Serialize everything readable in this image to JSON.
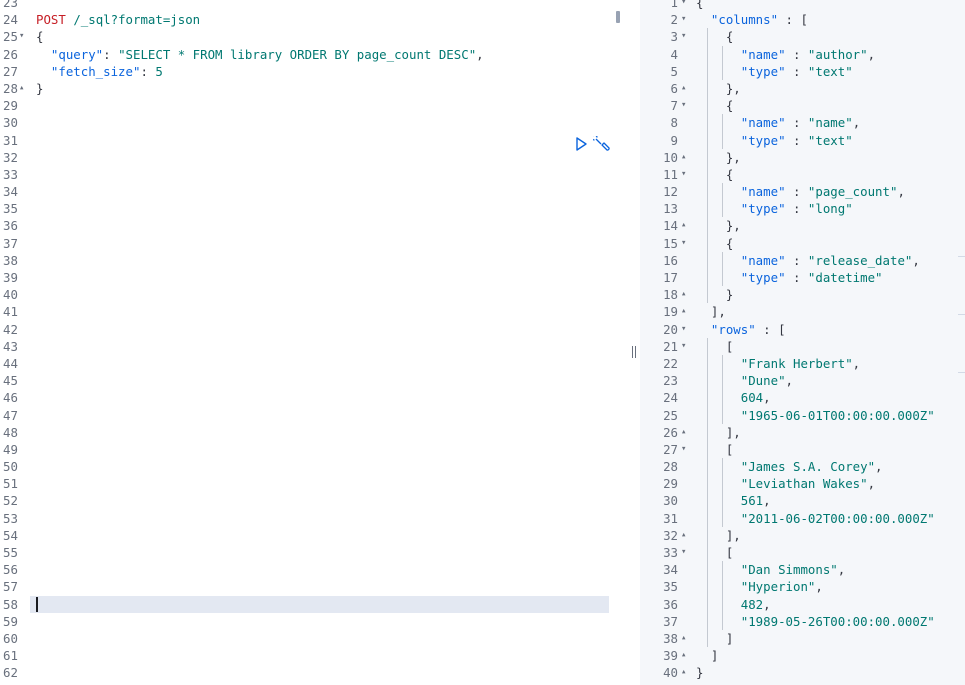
{
  "request": {
    "method": "POST",
    "path": "/_sql?format=json",
    "lines": [
      {
        "n": "23",
        "fold": "",
        "code": ""
      },
      {
        "n": "24",
        "fold": "",
        "code": "__REQ__"
      },
      {
        "n": "25",
        "fold": "▾",
        "code": "{"
      },
      {
        "n": "26",
        "fold": "",
        "code": "  \"query\": \"SELECT * FROM library ORDER BY page_count DESC\","
      },
      {
        "n": "27",
        "fold": "",
        "code": "  \"fetch_size\": 5"
      },
      {
        "n": "28",
        "fold": "▴",
        "code": "}"
      },
      {
        "n": "29",
        "fold": "",
        "code": ""
      },
      {
        "n": "30",
        "fold": "",
        "code": ""
      },
      {
        "n": "31",
        "fold": "",
        "code": ""
      },
      {
        "n": "32",
        "fold": "",
        "code": ""
      },
      {
        "n": "33",
        "fold": "",
        "code": ""
      },
      {
        "n": "34",
        "fold": "",
        "code": ""
      },
      {
        "n": "35",
        "fold": "",
        "code": ""
      },
      {
        "n": "36",
        "fold": "",
        "code": ""
      },
      {
        "n": "37",
        "fold": "",
        "code": ""
      },
      {
        "n": "38",
        "fold": "",
        "code": ""
      },
      {
        "n": "39",
        "fold": "",
        "code": ""
      },
      {
        "n": "40",
        "fold": "",
        "code": ""
      },
      {
        "n": "41",
        "fold": "",
        "code": ""
      },
      {
        "n": "42",
        "fold": "",
        "code": ""
      },
      {
        "n": "43",
        "fold": "",
        "code": ""
      },
      {
        "n": "44",
        "fold": "",
        "code": ""
      },
      {
        "n": "45",
        "fold": "",
        "code": ""
      },
      {
        "n": "46",
        "fold": "",
        "code": ""
      },
      {
        "n": "47",
        "fold": "",
        "code": ""
      },
      {
        "n": "48",
        "fold": "",
        "code": ""
      },
      {
        "n": "49",
        "fold": "",
        "code": ""
      },
      {
        "n": "50",
        "fold": "",
        "code": ""
      },
      {
        "n": "51",
        "fold": "",
        "code": ""
      },
      {
        "n": "52",
        "fold": "",
        "code": ""
      },
      {
        "n": "53",
        "fold": "",
        "code": ""
      },
      {
        "n": "54",
        "fold": "",
        "code": ""
      },
      {
        "n": "55",
        "fold": "",
        "code": ""
      },
      {
        "n": "56",
        "fold": "",
        "code": ""
      },
      {
        "n": "57",
        "fold": "",
        "code": ""
      },
      {
        "n": "58",
        "fold": "",
        "code": ""
      },
      {
        "n": "59",
        "fold": "",
        "code": ""
      },
      {
        "n": "60",
        "fold": "",
        "code": ""
      },
      {
        "n": "61",
        "fold": "",
        "code": ""
      },
      {
        "n": "62",
        "fold": "",
        "code": ""
      }
    ],
    "active_line": "58"
  },
  "actions": {
    "run_icon": "play-icon",
    "settings_icon": "wrench-icon"
  },
  "response": {
    "lines": [
      {
        "n": "1",
        "fold": "▾",
        "code": "{",
        "depth": 0
      },
      {
        "n": "2",
        "fold": "▾",
        "code": "  \"columns\" : [",
        "depth": 1
      },
      {
        "n": "3",
        "fold": "▾",
        "code": "    {",
        "depth": 2
      },
      {
        "n": "4",
        "fold": "",
        "code": "      \"name\" : \"author\",",
        "depth": 3
      },
      {
        "n": "5",
        "fold": "",
        "code": "      \"type\" : \"text\"",
        "depth": 3
      },
      {
        "n": "6",
        "fold": "▴",
        "code": "    },",
        "depth": 2
      },
      {
        "n": "7",
        "fold": "▾",
        "code": "    {",
        "depth": 2
      },
      {
        "n": "8",
        "fold": "",
        "code": "      \"name\" : \"name\",",
        "depth": 3
      },
      {
        "n": "9",
        "fold": "",
        "code": "      \"type\" : \"text\"",
        "depth": 3
      },
      {
        "n": "10",
        "fold": "▴",
        "code": "    },",
        "depth": 2
      },
      {
        "n": "11",
        "fold": "▾",
        "code": "    {",
        "depth": 2
      },
      {
        "n": "12",
        "fold": "",
        "code": "      \"name\" : \"page_count\",",
        "depth": 3
      },
      {
        "n": "13",
        "fold": "",
        "code": "      \"type\" : \"long\"",
        "depth": 3
      },
      {
        "n": "14",
        "fold": "▴",
        "code": "    },",
        "depth": 2
      },
      {
        "n": "15",
        "fold": "▾",
        "code": "    {",
        "depth": 2
      },
      {
        "n": "16",
        "fold": "",
        "code": "      \"name\" : \"release_date\",",
        "depth": 3
      },
      {
        "n": "17",
        "fold": "",
        "code": "      \"type\" : \"datetime\"",
        "depth": 3
      },
      {
        "n": "18",
        "fold": "▴",
        "code": "    }",
        "depth": 2
      },
      {
        "n": "19",
        "fold": "▴",
        "code": "  ],",
        "depth": 1
      },
      {
        "n": "20",
        "fold": "▾",
        "code": "  \"rows\" : [",
        "depth": 1
      },
      {
        "n": "21",
        "fold": "▾",
        "code": "    [",
        "depth": 2
      },
      {
        "n": "22",
        "fold": "",
        "code": "      \"Frank Herbert\",",
        "depth": 3
      },
      {
        "n": "23",
        "fold": "",
        "code": "      \"Dune\",",
        "depth": 3
      },
      {
        "n": "24",
        "fold": "",
        "code": "      604,",
        "depth": 3
      },
      {
        "n": "25",
        "fold": "",
        "code": "      \"1965-06-01T00:00:00.000Z\"",
        "depth": 3
      },
      {
        "n": "26",
        "fold": "▴",
        "code": "    ],",
        "depth": 2
      },
      {
        "n": "27",
        "fold": "▾",
        "code": "    [",
        "depth": 2
      },
      {
        "n": "28",
        "fold": "",
        "code": "      \"James S.A. Corey\",",
        "depth": 3
      },
      {
        "n": "29",
        "fold": "",
        "code": "      \"Leviathan Wakes\",",
        "depth": 3
      },
      {
        "n": "30",
        "fold": "",
        "code": "      561,",
        "depth": 3
      },
      {
        "n": "31",
        "fold": "",
        "code": "      \"2011-06-02T00:00:00.000Z\"",
        "depth": 3
      },
      {
        "n": "32",
        "fold": "▴",
        "code": "    ],",
        "depth": 2
      },
      {
        "n": "33",
        "fold": "▾",
        "code": "    [",
        "depth": 2
      },
      {
        "n": "34",
        "fold": "",
        "code": "      \"Dan Simmons\",",
        "depth": 3
      },
      {
        "n": "35",
        "fold": "",
        "code": "      \"Hyperion\",",
        "depth": 3
      },
      {
        "n": "36",
        "fold": "",
        "code": "      482,",
        "depth": 3
      },
      {
        "n": "37",
        "fold": "",
        "code": "      \"1989-05-26T00:00:00.000Z\"",
        "depth": 3
      },
      {
        "n": "38",
        "fold": "▴",
        "code": "    ]",
        "depth": 2
      },
      {
        "n": "39",
        "fold": "▴",
        "code": "  ]",
        "depth": 1
      },
      {
        "n": "40",
        "fold": "▴",
        "code": "}",
        "depth": 0
      }
    ]
  },
  "colors": {
    "method": "#c61e25",
    "key": "#0b64dd",
    "string": "#007871",
    "gutter_text": "#69707d",
    "active_line_bg": "#e3e8f2",
    "response_bg": "#f5f7fa"
  }
}
